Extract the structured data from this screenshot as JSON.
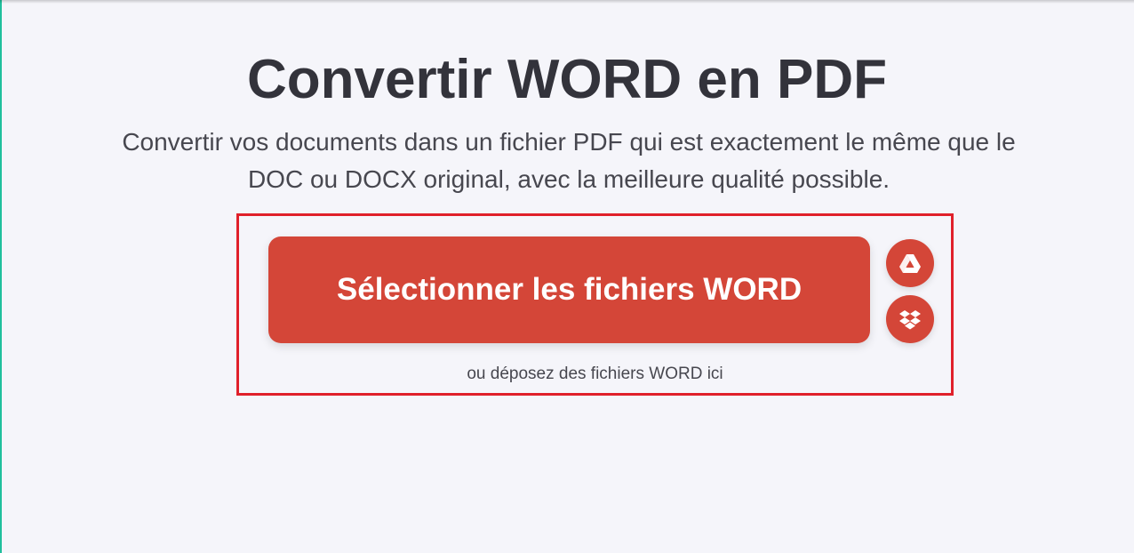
{
  "page": {
    "title": "Convertir WORD en PDF",
    "subtitle_line1": "Convertir vos documents dans un fichier PDF qui est exactement le même que le",
    "subtitle_line2": "DOC ou DOCX original, avec la meilleure qualité possible."
  },
  "upload": {
    "select_label": "Sélectionner les fichiers WORD",
    "drop_hint": "ou déposez des fichiers WORD ici",
    "cloud_buttons": [
      {
        "icon": "google-drive-icon"
      },
      {
        "icon": "dropbox-icon"
      }
    ]
  },
  "colors": {
    "brand_red": "#d44638",
    "highlight_border": "#e0202a",
    "accent_green": "#1fbf9c",
    "background": "#f5f5fa",
    "title_text": "#33333b"
  }
}
